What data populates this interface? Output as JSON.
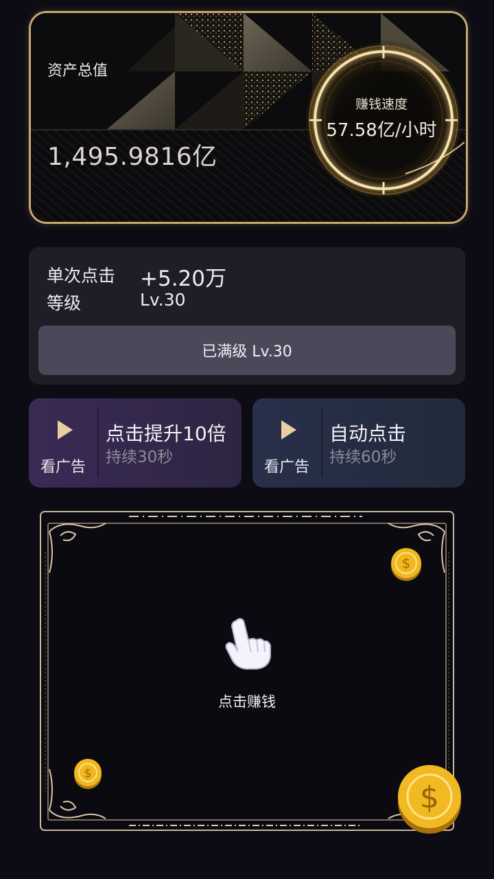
{
  "asset": {
    "label": "资产总值",
    "value": "1,495.9816亿"
  },
  "speed": {
    "label": "赚钱速度",
    "value": "57.58亿/小时"
  },
  "click": {
    "per_click_label": "单次点击",
    "per_click_value": "+5.20万",
    "level_label": "等级",
    "level_value": "Lv.30",
    "maxed_button_label": "已满级 Lv.30"
  },
  "ads": [
    {
      "watch_label": "看广告",
      "title": "点击提升10倍",
      "duration": "持续30秒"
    },
    {
      "watch_label": "看广告",
      "title": "自动点击",
      "duration": "持续60秒"
    }
  ],
  "tap_area": {
    "label": "点击赚钱"
  },
  "colors": {
    "background": "#0d0c14",
    "gold": "#c9a970",
    "panel": "#1f1e27",
    "button": "#4b4959",
    "coin": "#f0b81e"
  },
  "icons": [
    "play-icon",
    "pointing-hand-icon",
    "dollar-coin-icon"
  ]
}
